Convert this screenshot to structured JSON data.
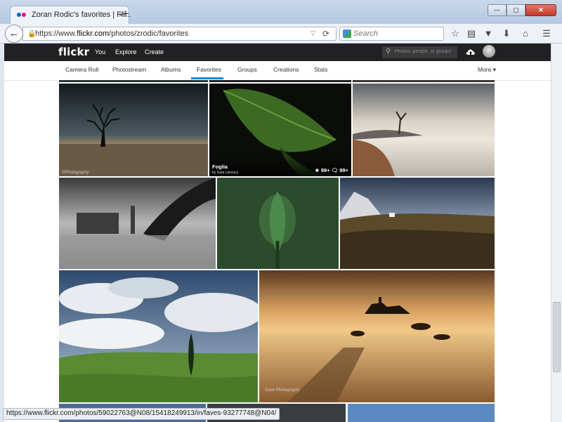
{
  "browser": {
    "tab_title": "Zoran Rodic's favorites | Fli...",
    "tab_close": "×",
    "new_tab": "+",
    "win_min": "—",
    "win_max": "▢",
    "win_close": "✕",
    "back_icon": "←",
    "url_prefix": "https://www.",
    "url_domain": "flickr.com",
    "url_path": "/photos/zrodic/favorites",
    "search_placeholder": "Search",
    "status_url": "https://www.flickr.com/photos/59022763@N08/15418249913/in/faves-93277748@N04/"
  },
  "flickr": {
    "logo": "flickr",
    "nav": [
      "You",
      "Explore",
      "Create"
    ],
    "search_placeholder": "Photos, people, or groups",
    "subnav": [
      "Camera Roll",
      "Photostream",
      "Albums",
      "Favorites",
      "Groups",
      "Creations",
      "Stats",
      "More ▾"
    ],
    "active_subnav": "Favorites",
    "hovered_photo": {
      "title": "Foglia",
      "author": "by Sara Lanzucy",
      "faves": "99+",
      "comments": "99+"
    },
    "watermarks": {
      "tree_photo": "©Photography",
      "coast_photo": "Dave Photography"
    }
  },
  "colors": {
    "flickr_bar": "#212124",
    "active_tab_underline": "#1b8ee0",
    "flickr_pink": "#ff0084",
    "flickr_blue": "#0063dc"
  }
}
